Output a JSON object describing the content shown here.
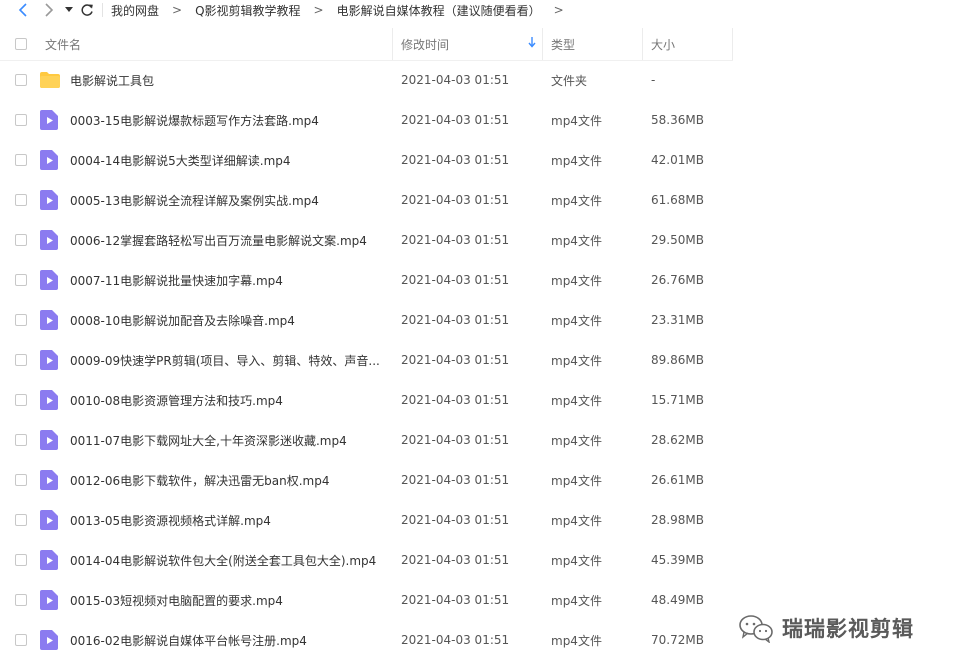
{
  "breadcrumb": [
    "我的网盘",
    "Q影视剪辑教学教程",
    "电影解说自媒体教程（建议随便看看）"
  ],
  "columns": {
    "name": "文件名",
    "modified": "修改时间",
    "type": "类型",
    "size": "大小"
  },
  "files": [
    {
      "name": "电影解说工具包",
      "modified": "2021-04-03 01:51",
      "type": "文件夹",
      "size": "-",
      "kind": "folder"
    },
    {
      "name": "0003-15电影解说爆款标题写作方法套路.mp4",
      "modified": "2021-04-03 01:51",
      "type": "mp4文件",
      "size": "58.36MB",
      "kind": "video"
    },
    {
      "name": "0004-14电影解说5大类型详细解读.mp4",
      "modified": "2021-04-03 01:51",
      "type": "mp4文件",
      "size": "42.01MB",
      "kind": "video"
    },
    {
      "name": "0005-13电影解说全流程详解及案例实战.mp4",
      "modified": "2021-04-03 01:51",
      "type": "mp4文件",
      "size": "61.68MB",
      "kind": "video"
    },
    {
      "name": "0006-12掌握套路轻松写出百万流量电影解说文案.mp4",
      "modified": "2021-04-03 01:51",
      "type": "mp4文件",
      "size": "29.50MB",
      "kind": "video"
    },
    {
      "name": "0007-11电影解说批量快速加字幕.mp4",
      "modified": "2021-04-03 01:51",
      "type": "mp4文件",
      "size": "26.76MB",
      "kind": "video"
    },
    {
      "name": "0008-10电影解说加配音及去除噪音.mp4",
      "modified": "2021-04-03 01:51",
      "type": "mp4文件",
      "size": "23.31MB",
      "kind": "video"
    },
    {
      "name": "0009-09快速学PR剪辑(项目、导入、剪辑、特效、声音...",
      "modified": "2021-04-03 01:51",
      "type": "mp4文件",
      "size": "89.86MB",
      "kind": "video"
    },
    {
      "name": "0010-08电影资源管理方法和技巧.mp4",
      "modified": "2021-04-03 01:51",
      "type": "mp4文件",
      "size": "15.71MB",
      "kind": "video"
    },
    {
      "name": "0011-07电影下载网址大全,十年资深影迷收藏.mp4",
      "modified": "2021-04-03 01:51",
      "type": "mp4文件",
      "size": "28.62MB",
      "kind": "video"
    },
    {
      "name": "0012-06电影下载软件，解决迅雷无ban权.mp4",
      "modified": "2021-04-03 01:51",
      "type": "mp4文件",
      "size": "26.61MB",
      "kind": "video"
    },
    {
      "name": "0013-05电影资源视频格式详解.mp4",
      "modified": "2021-04-03 01:51",
      "type": "mp4文件",
      "size": "28.98MB",
      "kind": "video"
    },
    {
      "name": "0014-04电影解说软件包大全(附送全套工具包大全).mp4",
      "modified": "2021-04-03 01:51",
      "type": "mp4文件",
      "size": "45.39MB",
      "kind": "video"
    },
    {
      "name": "0015-03短视频对电脑配置的要求.mp4",
      "modified": "2021-04-03 01:51",
      "type": "mp4文件",
      "size": "48.49MB",
      "kind": "video"
    },
    {
      "name": "0016-02电影解说自媒体平台帐号注册.mp4",
      "modified": "2021-04-03 01:51",
      "type": "mp4文件",
      "size": "70.72MB",
      "kind": "video"
    }
  ],
  "watermark": {
    "text": "瑞瑞影视剪辑",
    "icon": "wechat-icon"
  },
  "colors": {
    "accent": "#3b8cff",
    "folder": "#ffc940",
    "video": "#8b7bf0"
  }
}
